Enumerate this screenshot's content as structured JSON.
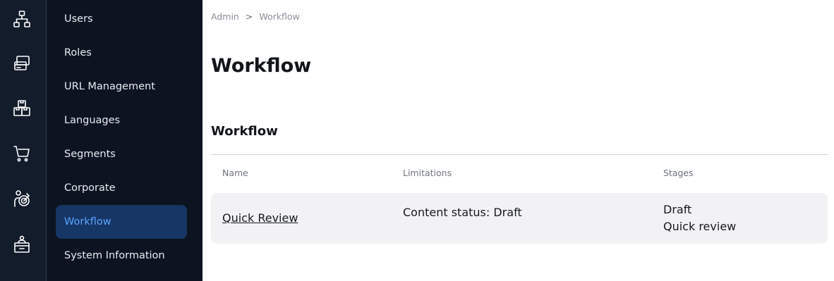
{
  "icon_rail": [
    {
      "icon": "sitemap-icon"
    },
    {
      "icon": "content-cards-icon"
    },
    {
      "icon": "product-boxes-icon"
    },
    {
      "icon": "cart-icon"
    },
    {
      "icon": "target-person-icon"
    },
    {
      "icon": "admin-panel-icon"
    }
  ],
  "sidebar": {
    "items": [
      {
        "label": "Users"
      },
      {
        "label": "Roles"
      },
      {
        "label": "URL Management"
      },
      {
        "label": "Languages"
      },
      {
        "label": "Segments"
      },
      {
        "label": "Corporate"
      },
      {
        "label": "Workflow",
        "active": true
      },
      {
        "label": "System Information"
      }
    ]
  },
  "breadcrumb": {
    "root": "Admin",
    "separator": ">",
    "current": "Workflow"
  },
  "page_title": "Workflow",
  "section_title": "Workflow",
  "table": {
    "columns": [
      "Name",
      "Limitations",
      "Stages"
    ],
    "rows": [
      {
        "name": "Quick Review",
        "limitations": "Content status: Draft",
        "stages": [
          "Draft",
          "Quick review"
        ]
      }
    ]
  },
  "colors": {
    "rail_bg": "#131c2b",
    "nav_bg": "#0d1421",
    "active_bg": "#163665",
    "active_text": "#5aa2ff",
    "row_bg": "#f2f2f4"
  }
}
